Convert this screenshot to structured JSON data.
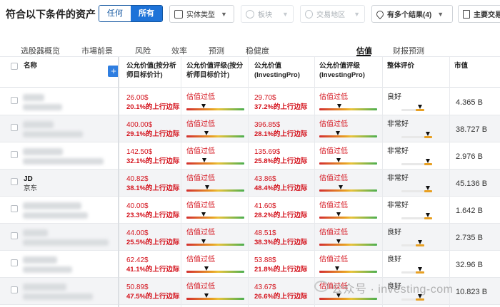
{
  "header": {
    "title": "符合以下条件的资产",
    "toggle": {
      "any": "任何",
      "all": "所有"
    },
    "filters": [
      {
        "label": "实体类型",
        "icon": "cube-icon",
        "enabled": true
      },
      {
        "label": "板块",
        "icon": "circle-icon",
        "enabled": false
      },
      {
        "label": "交易地区",
        "icon": "globe-icon",
        "enabled": false
      },
      {
        "label": "有多个结果(4)",
        "icon": "location-pin-icon",
        "enabled": true
      },
      {
        "label": "主要交易",
        "icon": "document-icon",
        "enabled": true
      }
    ]
  },
  "tabs": [
    "选股器概览",
    "市場前景",
    "风险",
    "效率",
    "预测",
    "稳健度",
    "估值",
    "财报预测"
  ],
  "active_tab": "估值",
  "columns": [
    "名称",
    "公允价值(按分析师目标价计)",
    "公允价值评级(按分析师目标价计)",
    "公允价值 (InvestingPro)",
    "公允价值评级 (InvestingPro)",
    "整体评价",
    "市值"
  ],
  "rows": [
    {
      "name": "",
      "sub": "",
      "fv_analyst": "26.00$",
      "up_analyst": "20.1%的上行边际",
      "rating_analyst": "估值过低",
      "fv_pro": "29.70$",
      "up_pro": "37.2%的上行边际",
      "rating_pro": "估值过低",
      "overall": "良好",
      "mcap": "4.365 B"
    },
    {
      "name": "",
      "sub": "",
      "fv_analyst": "400.00$",
      "up_analyst": "29.1%的上行边际",
      "rating_analyst": "估值过低",
      "fv_pro": "396.85$",
      "up_pro": "28.1%的上行边际",
      "rating_pro": "估值过低",
      "overall": "非常好",
      "mcap": "38.727 B"
    },
    {
      "name": "",
      "sub": "",
      "fv_analyst": "142.50$",
      "up_analyst": "32.1%的上行边际",
      "rating_analyst": "估值过低",
      "fv_pro": "135.69$",
      "up_pro": "25.8%的上行边际",
      "rating_pro": "估值过低",
      "overall": "非常好",
      "mcap": "2.976 B"
    },
    {
      "name": "JD",
      "sub": "京东",
      "fv_analyst": "40.82$",
      "up_analyst": "38.1%的上行边际",
      "rating_analyst": "估值过低",
      "fv_pro": "43.86$",
      "up_pro": "48.4%的上行边际",
      "rating_pro": "估值过低",
      "overall": "非常好",
      "mcap": "45.136 B"
    },
    {
      "name": "",
      "sub": "",
      "fv_analyst": "40.00$",
      "up_analyst": "23.3%的上行边际",
      "rating_analyst": "估值过低",
      "fv_pro": "41.60$",
      "up_pro": "28.2%的上行边际",
      "rating_pro": "估值过低",
      "overall": "非常好",
      "mcap": "1.642 B"
    },
    {
      "name": "",
      "sub": "",
      "fv_analyst": "44.00$",
      "up_analyst": "25.5%的上行边际",
      "rating_analyst": "估值过低",
      "fv_pro": "48.51$",
      "up_pro": "38.3%的上行边际",
      "rating_pro": "估值过低",
      "overall": "良好",
      "mcap": "2.735 B"
    },
    {
      "name": "",
      "sub": "",
      "fv_analyst": "62.42$",
      "up_analyst": "41.1%的上行边际",
      "rating_analyst": "估值过低",
      "fv_pro": "53.88$",
      "up_pro": "21.8%的上行边际",
      "rating_pro": "估值过低",
      "overall": "良好",
      "mcap": "32.96 B"
    },
    {
      "name": "",
      "sub": "",
      "fv_analyst": "50.89$",
      "up_analyst": "47.5%的上行边际",
      "rating_analyst": "估值过低",
      "fv_pro": "43.67$",
      "up_pro": "26.6%的上行边际",
      "rating_pro": "估值过低",
      "overall": "良好",
      "mcap": "10.823 B"
    }
  ],
  "gauge_levels": {
    "analyst": [
      0.3,
      0.35,
      0.32,
      0.36,
      0.3,
      0.3,
      0.35,
      0.35
    ],
    "pro": [
      0.35,
      0.33,
      0.34,
      0.38,
      0.34,
      0.34,
      0.32,
      0.34
    ],
    "overall": [
      0.45,
      0.65,
      0.65,
      0.65,
      0.65,
      0.45,
      0.45,
      0.45
    ]
  },
  "watermark": "公众号 · investing-com",
  "colors": {
    "accent": "#1e73d8",
    "down": "#d4111b"
  }
}
